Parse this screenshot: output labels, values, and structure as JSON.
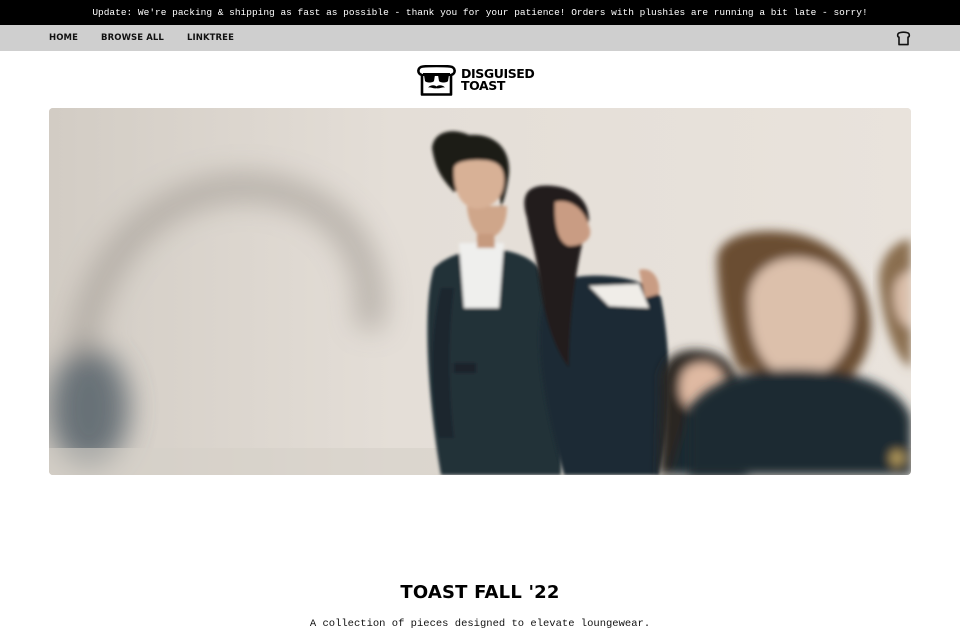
{
  "announcement": {
    "text": "Update: We're packing & shipping as fast as possible - thank you for your patience! Orders with plushies are running a bit late - sorry!"
  },
  "nav": {
    "items": [
      {
        "label": "HOME"
      },
      {
        "label": "BROWSE ALL"
      },
      {
        "label": "LINKTREE"
      }
    ],
    "cart_icon": "toast-cart-icon"
  },
  "brand": {
    "logo_icon": "toast-sunglasses-logo",
    "line1": "DISGUISED",
    "line2": "TOAST"
  },
  "hero": {
    "image": "fall-collection-models-photo"
  },
  "collection": {
    "title": "TOAST FALL '22",
    "description": "A collection of pieces designed to elevate loungewear."
  },
  "colors": {
    "announcement_bg": "#000000",
    "nav_bg": "#cfcfcf",
    "text": "#111111"
  }
}
